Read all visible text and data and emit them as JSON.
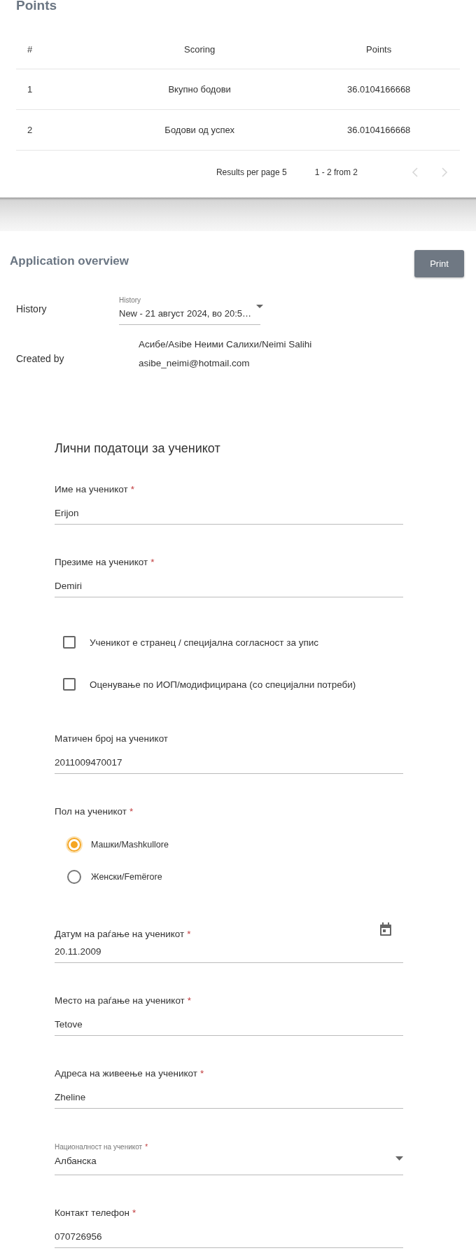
{
  "points_card": {
    "title": "Points",
    "table": {
      "columns": [
        "#",
        "Scoring",
        "Points"
      ],
      "rows": [
        [
          "1",
          "Вкупно бодови",
          "36.0104166668"
        ],
        [
          "2",
          "Бодови од успех",
          "36.0104166668"
        ]
      ]
    },
    "pagination": {
      "per_page_label": "Results per page",
      "per_page": "5",
      "range": "1 - 2 from 2",
      "prev_disabled": true,
      "next_disabled": true
    }
  },
  "overview": {
    "title": "Application overview",
    "print_button": "Print",
    "history": {
      "label": "History",
      "field_label": "History",
      "value": "New - 21 август 2024, во 20:5…"
    },
    "created_by": {
      "label": "Created by",
      "name": "Асибе/Asibe Неими Салихи/Neimi Salihi",
      "email": "asibe_neimi@hotmail.com"
    }
  },
  "form": {
    "title": "Лични податоци за ученикот",
    "fields": [
      {
        "kind": "text",
        "label": "Име на ученикот",
        "required_mark": "*",
        "value": "Erijon"
      },
      {
        "kind": "text",
        "label": "Презиме на ученикот",
        "required_mark": "*",
        "value": "Demiri"
      },
      {
        "kind": "checkbox",
        "label": "Ученикот е странец / специјална согласност за упис",
        "checked": false
      },
      {
        "kind": "checkbox",
        "label": "Оценување по ИОП/модифицирана (со специјални потреби)",
        "checked": false
      },
      {
        "kind": "text",
        "label": "Матичен број на ученикот",
        "value": "2011009470017"
      },
      {
        "kind": "radio",
        "label": "Пол на ученикот",
        "required_mark": "*",
        "options": [
          {
            "label": "Машки/Mashkullore",
            "selected": true
          },
          {
            "label": "Женски/Femërore",
            "selected": false
          }
        ]
      },
      {
        "kind": "date",
        "label": "Датум на раѓање на ученикот",
        "required_mark": "*",
        "value": "20.11.2009"
      },
      {
        "kind": "text",
        "label": "Место на раѓање на ученикот",
        "required_mark": "*",
        "value": "Tetove"
      },
      {
        "kind": "text",
        "label": "Адреса на живеење на ученикот",
        "required_mark": "*",
        "value": "Zheline"
      },
      {
        "kind": "select",
        "label": "Националност на ученикот",
        "required_mark": "*",
        "value": "Албанска"
      },
      {
        "kind": "text",
        "label": "Контакт телефон",
        "required_mark": "*",
        "value": "070726956"
      }
    ]
  }
}
